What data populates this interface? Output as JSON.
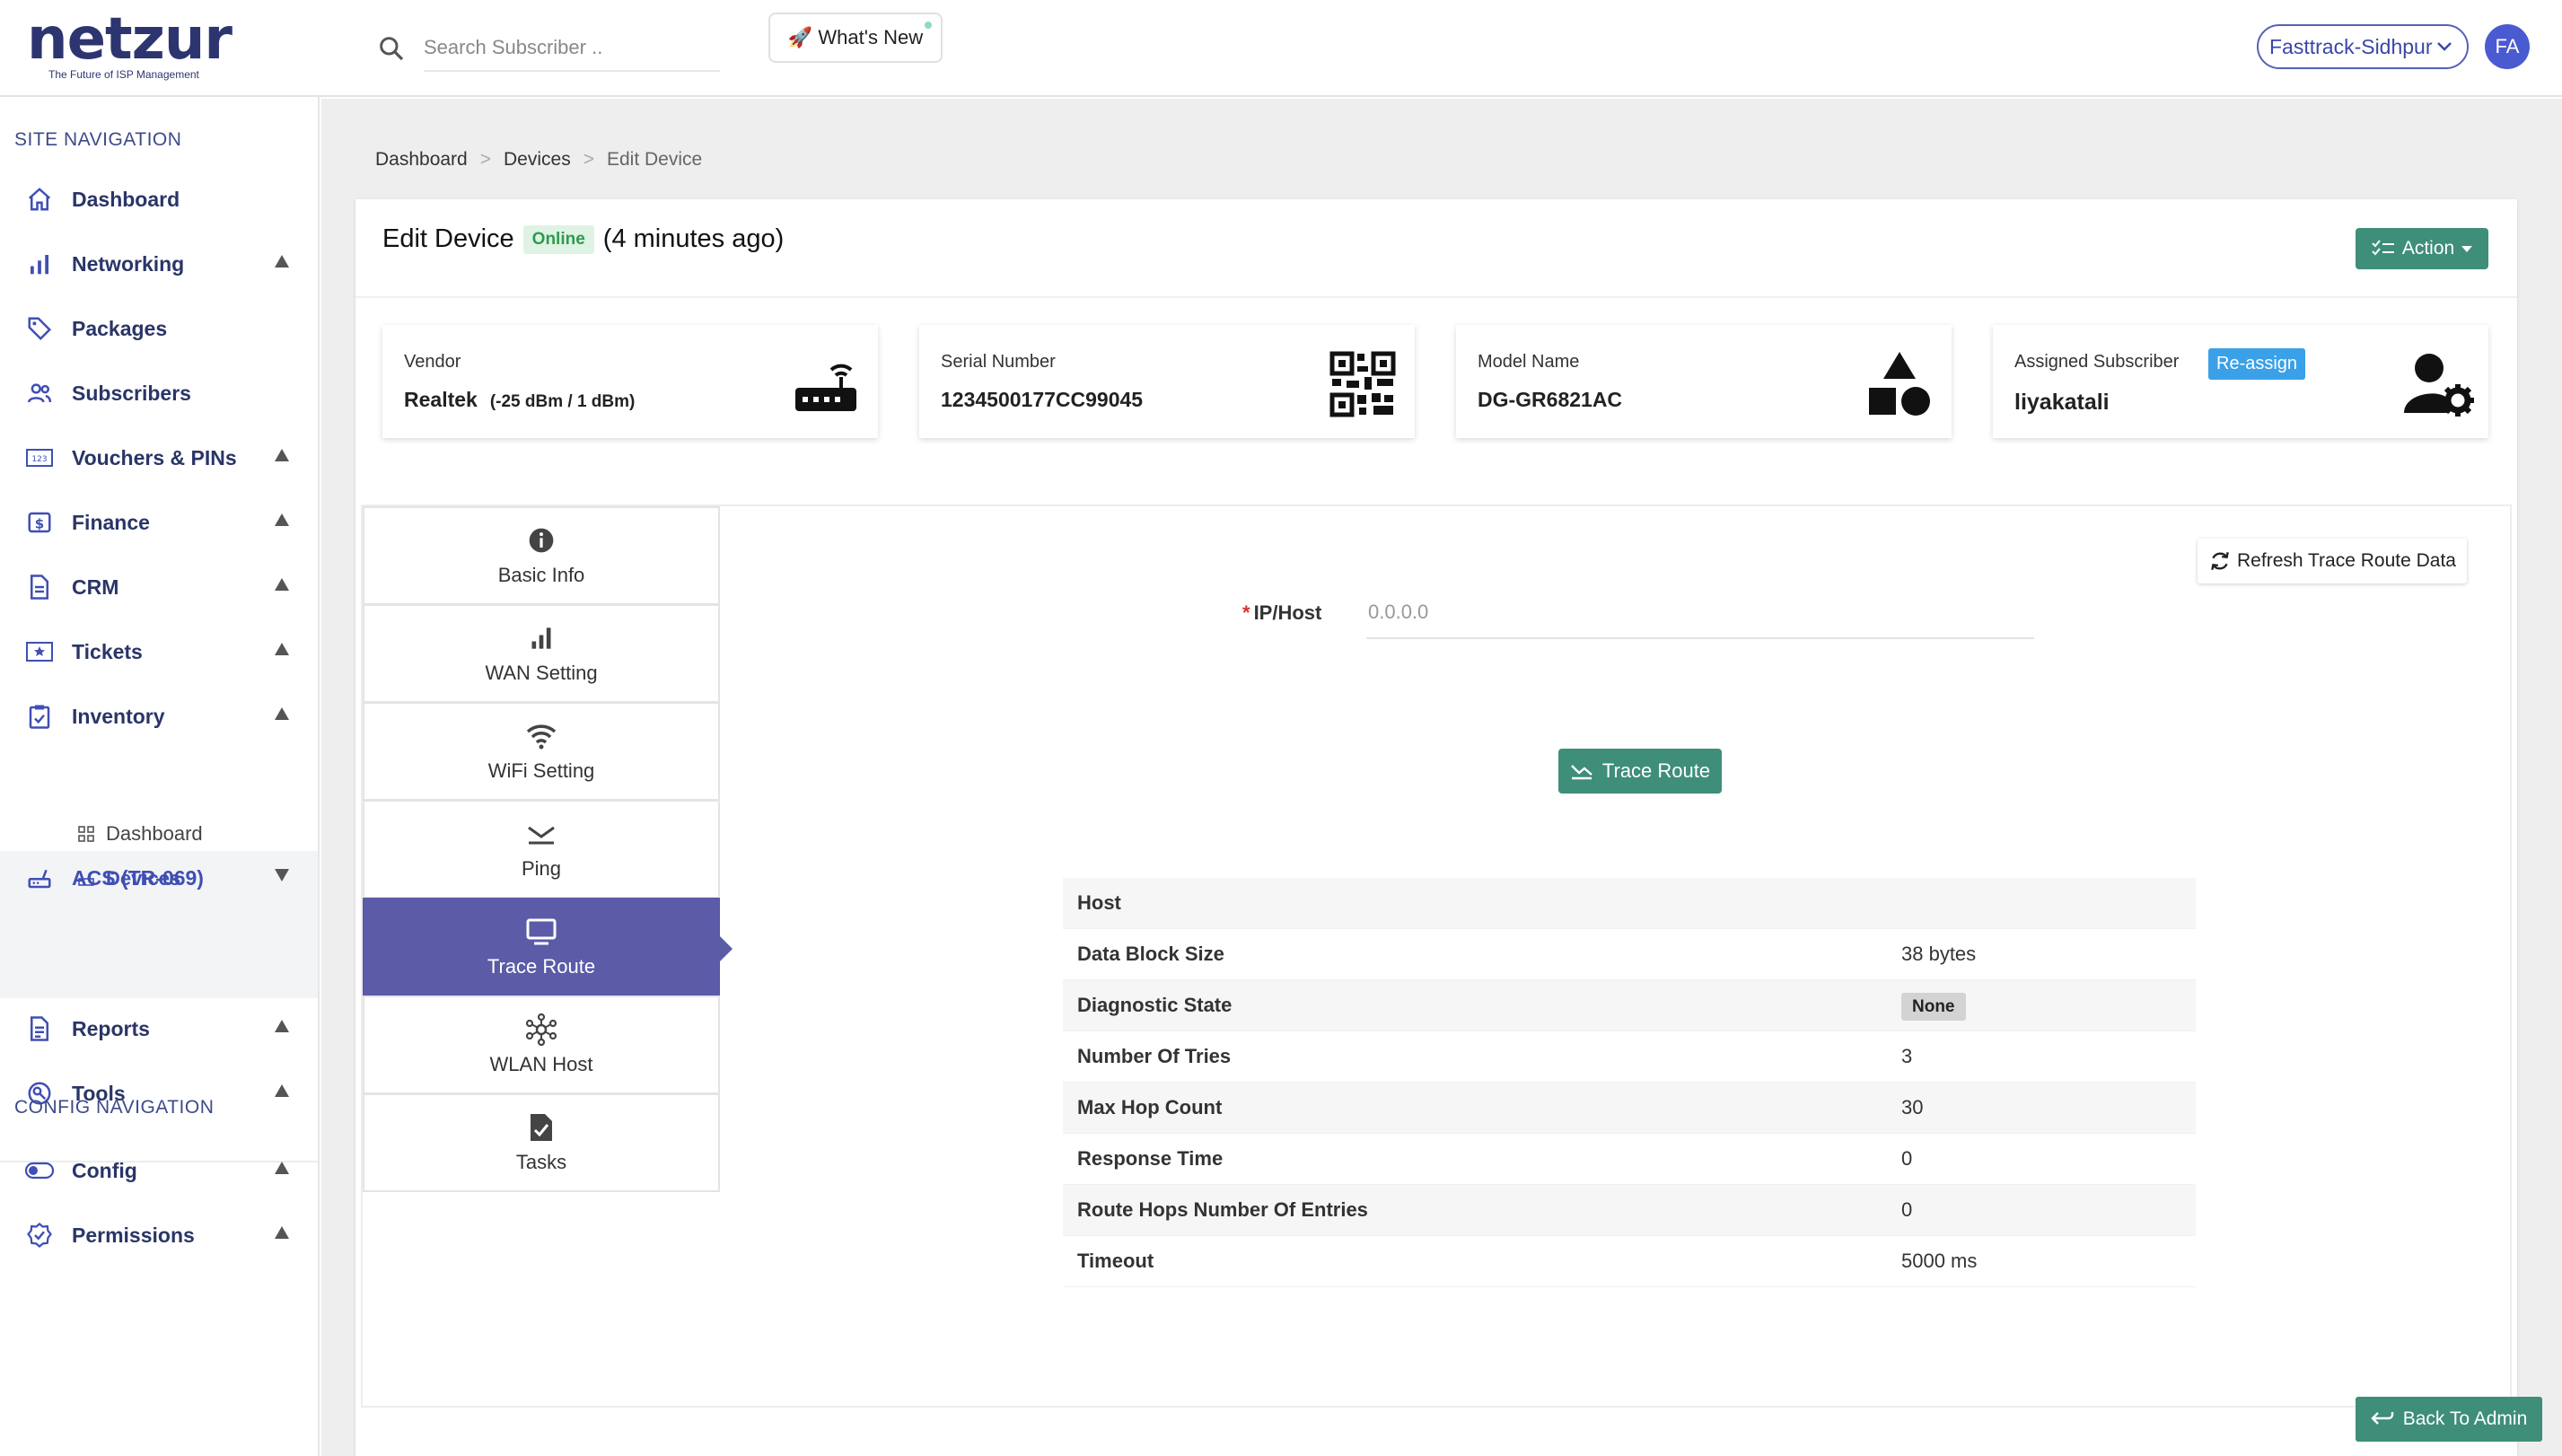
{
  "header": {
    "logo_text": "netzur",
    "logo_tagline": "The Future of ISP Management",
    "search_placeholder": "Search Subscriber ..",
    "whats_new_label": "🚀 What's New",
    "org_select": "Fasttrack-Sidhpur",
    "avatar_initials": "FA"
  },
  "sidebar": {
    "site_nav_title": "SITE NAVIGATION",
    "items": [
      {
        "label": "Dashboard",
        "icon": "home-icon"
      },
      {
        "label": "Networking",
        "icon": "bar-chart-icon"
      },
      {
        "label": "Packages",
        "icon": "tag-icon"
      },
      {
        "label": "Subscribers",
        "icon": "users-icon"
      },
      {
        "label": "Vouchers & PINs",
        "icon": "voucher-icon"
      },
      {
        "label": "Finance",
        "icon": "dollar-icon"
      },
      {
        "label": "CRM",
        "icon": "document-icon"
      },
      {
        "label": "Tickets",
        "icon": "ticket-icon"
      },
      {
        "label": "Inventory",
        "icon": "clipboard-icon"
      },
      {
        "label": "ACS (TR-069)",
        "icon": "router-icon"
      },
      {
        "label": "Reports",
        "icon": "report-icon"
      },
      {
        "label": "Tools",
        "icon": "tools-icon"
      }
    ],
    "acs_sub": [
      {
        "label": "Dashboard",
        "icon": "grid-icon"
      },
      {
        "label": "Devices",
        "icon": "device-icon"
      }
    ],
    "config_nav_title": "CONFIG NAVIGATION",
    "config_items": [
      {
        "label": "Config",
        "icon": "toggle-icon"
      },
      {
        "label": "Permissions",
        "icon": "shield-check-icon"
      }
    ]
  },
  "breadcrumb": {
    "items": [
      "Dashboard",
      "Devices",
      "Edit Device"
    ],
    "separator": ">"
  },
  "device": {
    "title": "Edit Device",
    "status": "Online",
    "last_seen": "(4 minutes ago)",
    "action_label": "Action",
    "vendor_label": "Vendor",
    "vendor": "Realtek",
    "vendor_signal": "(-25 dBm / 1 dBm)",
    "serial_label": "Serial Number",
    "serial": "1234500177CC99045",
    "model_label": "Model Name",
    "model": "DG-GR6821AC",
    "subscriber_label": "Assigned Subscriber",
    "subscriber": "liyakatali",
    "reassign_label": "Re-assign"
  },
  "tabs": [
    {
      "label": "Basic Info",
      "icon": "info-icon"
    },
    {
      "label": "WAN Setting",
      "icon": "signal-bars-icon"
    },
    {
      "label": "WiFi Setting",
      "icon": "wifi-icon"
    },
    {
      "label": "Ping",
      "icon": "ping-icon"
    },
    {
      "label": "Trace Route",
      "icon": "monitor-icon"
    },
    {
      "label": "WLAN Host",
      "icon": "network-hub-icon"
    },
    {
      "label": "Tasks",
      "icon": "task-check-icon"
    }
  ],
  "active_tab": "Trace Route",
  "trace": {
    "refresh_label": "Refresh Trace Route Data",
    "ip_label": "IP/Host",
    "required_mark": "*",
    "ip_placeholder": "0.0.0.0",
    "trace_label": "Trace Route",
    "rows": [
      {
        "key": "Host",
        "value": ""
      },
      {
        "key": "Data Block Size",
        "value": "38 bytes"
      },
      {
        "key": "Diagnostic State",
        "value": "None"
      },
      {
        "key": "Number Of Tries",
        "value": "3"
      },
      {
        "key": "Max Hop Count",
        "value": "30"
      },
      {
        "key": "Response Time",
        "value": "0"
      },
      {
        "key": "Route Hops Number Of Entries",
        "value": "0"
      },
      {
        "key": "Timeout",
        "value": "5000 ms"
      }
    ]
  },
  "back_to_admin": "Back To Admin",
  "colors": {
    "brand": "#2d3570",
    "accent": "#3f4fb5",
    "green_button": "#3e8e79",
    "active_tab": "#5b5ba8",
    "online_badge": "#2e9b4e",
    "reassign": "#3aa0e8"
  }
}
